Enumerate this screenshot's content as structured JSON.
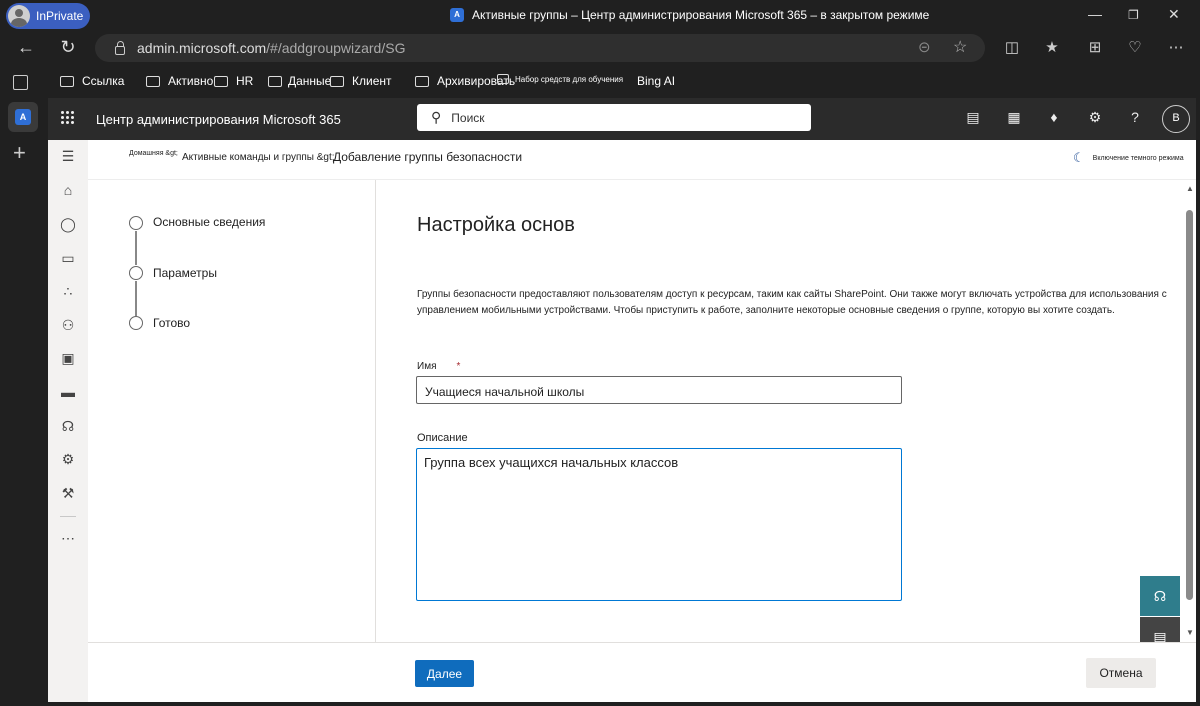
{
  "browser": {
    "inprivate_label": "InPrivate",
    "window_title": "Активные группы – Центр администрирования Microsoft 365 – в закрытом режиме",
    "tab_icon_text": "A",
    "url_host": "admin.microsoft.com",
    "url_path": "/#/addgroupwizard/SG"
  },
  "favorites": [
    {
      "label": "Ссылка"
    },
    {
      "label": "Активно"
    },
    {
      "label": "HR"
    },
    {
      "label": "Данные"
    },
    {
      "label": "Клиент"
    },
    {
      "label": "Архивировать"
    },
    {
      "label": "Набор средств для обучения"
    },
    {
      "label": "Bing AI"
    }
  ],
  "header": {
    "app_title": "Центр администрирования Microsoft 365",
    "search_placeholder": "Поиск",
    "avatar_initial": "B"
  },
  "breadcrumb": {
    "home": "Домашняя &gt;",
    "teams": "Активные команды и группы &gt;",
    "current": "Добавление группы безопасности"
  },
  "dark_mode_label": "Включение темного режима",
  "steps": [
    {
      "label": "Основные сведения"
    },
    {
      "label": "Параметры"
    },
    {
      "label": "Готово"
    }
  ],
  "main": {
    "title": "Настройка основ",
    "description": "Группы безопасности предоставляют пользователям доступ к ресурсам, таким как сайты SharePoint. Они также могут включать устройства для использования с управлением мобильными устройствами. Чтобы приступить к работе, заполните некоторые основные сведения о группе, которую вы хотите создать.",
    "name_label": "Имя",
    "required_mark": "*",
    "name_value": "Учащиеся начальной школы",
    "description_label": "Описание",
    "description_value": "Группа всех учащихся начальных классов"
  },
  "footer": {
    "next_label": "Далее",
    "cancel_label": "Отмена"
  },
  "colors": {
    "accent": "#0f6cbd",
    "header_bg": "#2b2b2b",
    "required": "#a4262c",
    "help_button": "#2f7d8c"
  }
}
